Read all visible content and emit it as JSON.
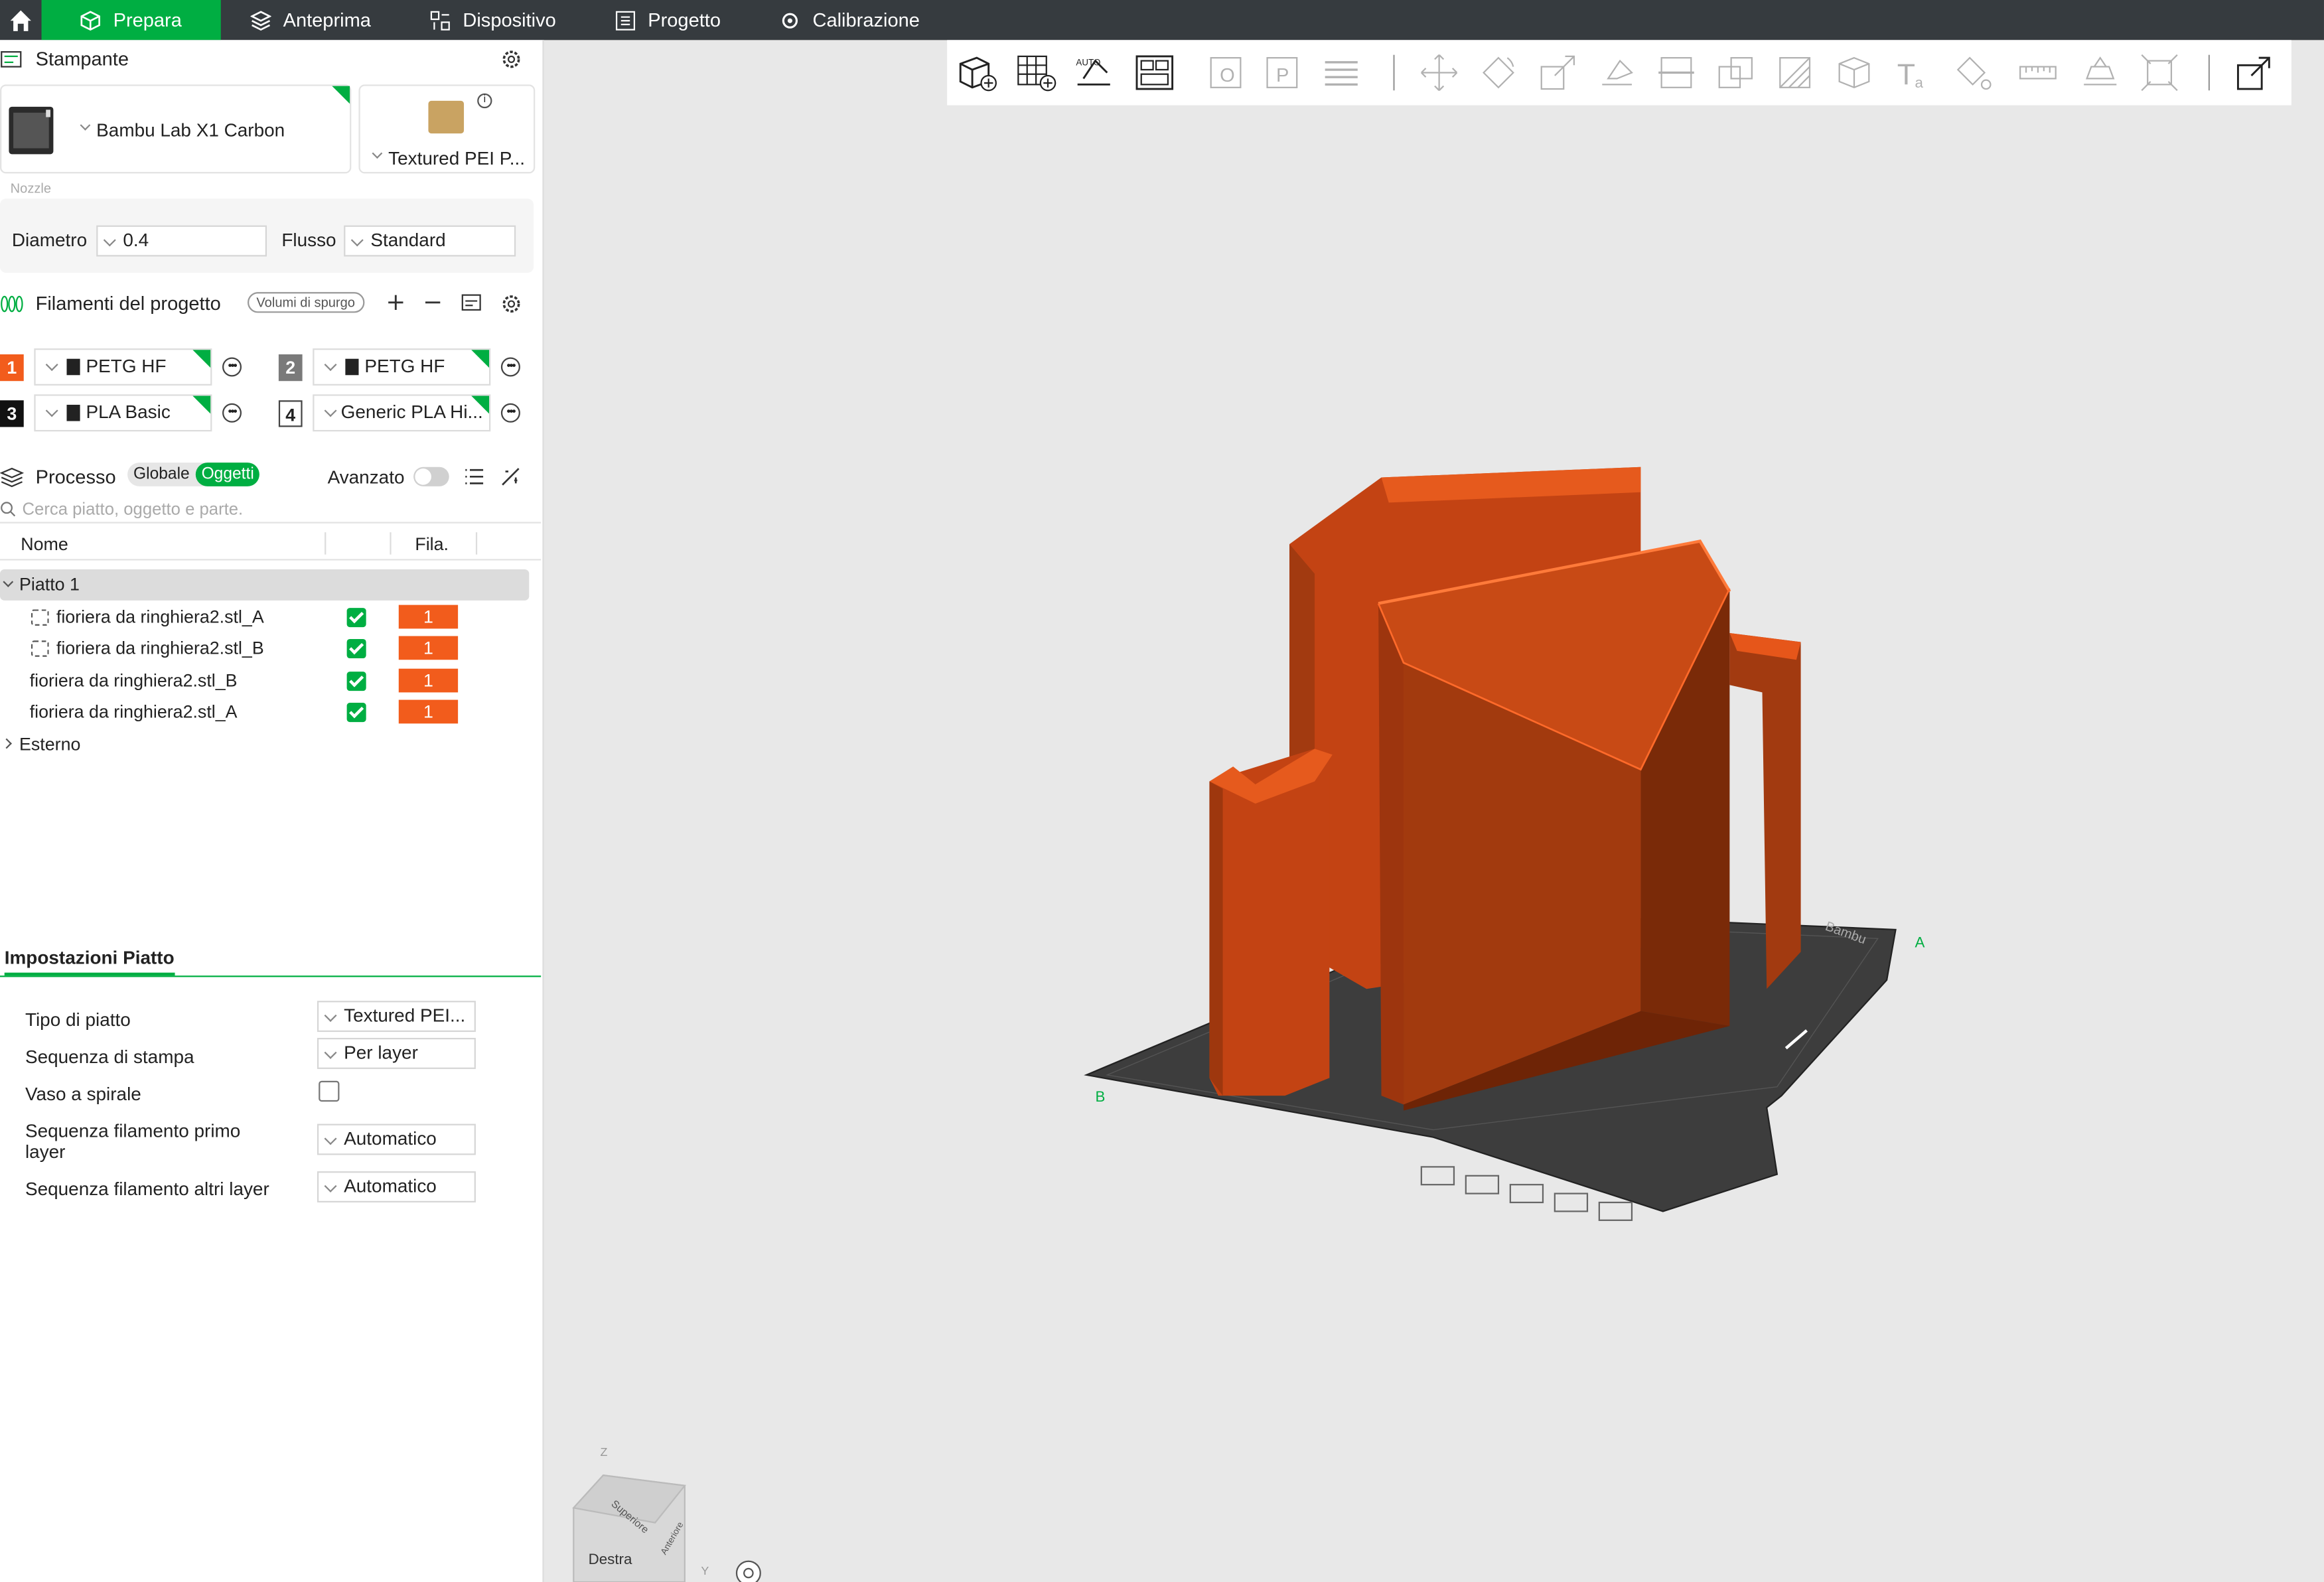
{
  "tabs": [
    {
      "label": "Prepara",
      "icon": "cube-icon",
      "active": true
    },
    {
      "label": "Anteprima",
      "icon": "layers-icon"
    },
    {
      "label": "Dispositivo",
      "icon": "device-icon"
    },
    {
      "label": "Progetto",
      "icon": "list-icon"
    },
    {
      "label": "Calibrazione",
      "icon": "calibration-icon"
    }
  ],
  "printer": {
    "section_title": "Stampante",
    "name": "Bambu Lab X1 Carbon",
    "plate": "Textured PEI P...",
    "nozzle_label": "Nozzle",
    "diameter_label": "Diametro",
    "diameter_value": "0.4",
    "flow_label": "Flusso",
    "flow_value": "Standard"
  },
  "filaments": {
    "section_title": "Filamenti del progetto",
    "purge_button": "Volumi di spurgo",
    "items": [
      {
        "num": "1",
        "name": "PETG HF",
        "color": "#f25c1c"
      },
      {
        "num": "2",
        "name": "PETG HF",
        "color": "#7a7a7a"
      },
      {
        "num": "3",
        "name": "PLA Basic",
        "color": "#111111"
      },
      {
        "num": "4",
        "name": "Generic PLA Hi...",
        "color": "#ffffff"
      }
    ]
  },
  "process": {
    "section_title": "Processo",
    "global_label": "Globale",
    "objects_label": "Oggetti",
    "advanced_label": "Avanzato",
    "search_placeholder": "Cerca piatto, oggetto e parte.",
    "col_name": "Nome",
    "col_fila": "Fila.",
    "plate_name": "Piatto 1",
    "objects": [
      {
        "name": "fioriera da ringhiera2.stl_A",
        "fila": "1",
        "part": true
      },
      {
        "name": "fioriera da ringhiera2.stl_B",
        "fila": "1",
        "part": true
      },
      {
        "name": "fioriera da ringhiera2.stl_B",
        "fila": "1",
        "part": false
      },
      {
        "name": "fioriera da ringhiera2.stl_A",
        "fila": "1",
        "part": false
      }
    ],
    "external_label": "Esterno"
  },
  "plate_settings": {
    "title": "Impostazioni Piatto",
    "rows": [
      {
        "label": "Tipo di piatto",
        "value": "Textured PEI..."
      },
      {
        "label": "Sequenza di stampa",
        "value": "Per layer"
      },
      {
        "label": "Vaso a spirale",
        "value": ""
      },
      {
        "label": "Sequenza filamento primo layer",
        "value": "Automatico"
      },
      {
        "label": "Sequenza filamento altri layer",
        "value": "Automatico"
      }
    ]
  },
  "viewport": {
    "cube_label_right": "Destra",
    "cube_label_top": "Superiore",
    "cube_label_front": "Anteriore",
    "axis_z": "Z",
    "axis_y": "Y",
    "bed_brand": "Bambu",
    "bed_label_a": "A",
    "bed_label_b": "B",
    "model_color": "#f25c1c"
  }
}
